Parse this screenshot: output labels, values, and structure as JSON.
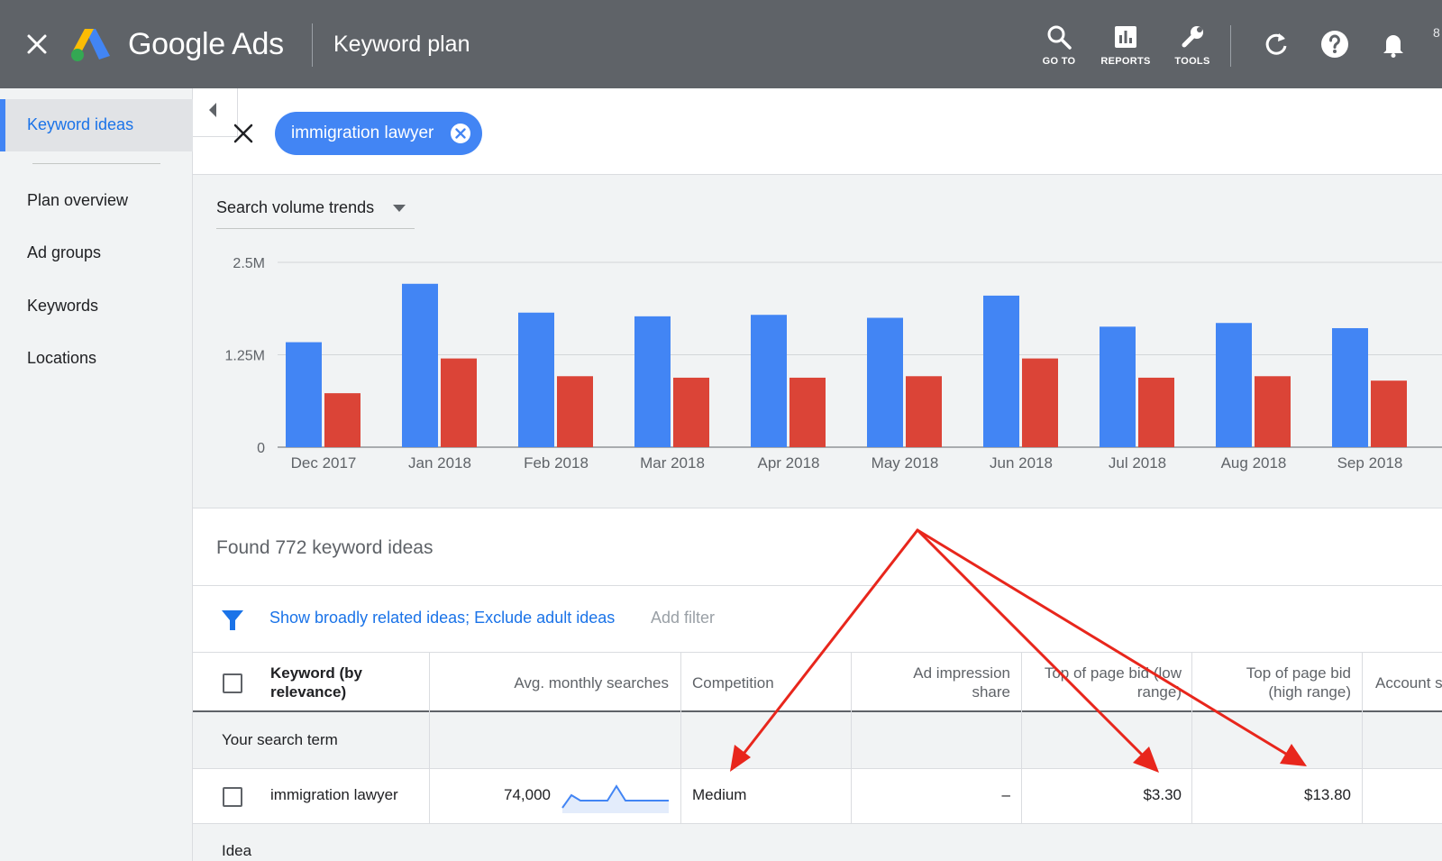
{
  "topbar": {
    "brand": "Google Ads",
    "title": "Keyword plan",
    "tools": [
      {
        "label": "GO TO",
        "icon": "search-icon"
      },
      {
        "label": "REPORTS",
        "icon": "reports-icon"
      },
      {
        "label": "TOOLS",
        "icon": "wrench-icon"
      }
    ],
    "right_icons": [
      "refresh-icon",
      "help-icon",
      "notifications-icon"
    ],
    "partial_text": "8"
  },
  "sidebar": {
    "items": [
      {
        "label": "Keyword ideas",
        "active": true
      },
      {
        "label": "Plan overview"
      },
      {
        "label": "Ad groups"
      },
      {
        "label": "Keywords"
      },
      {
        "label": "Locations"
      }
    ]
  },
  "search": {
    "chip": "immigration lawyer"
  },
  "chart": {
    "dropdown": "Search volume trends"
  },
  "chart_data": {
    "type": "bar",
    "categories": [
      "Dec 2017",
      "Jan 2018",
      "Feb 2018",
      "Mar 2018",
      "Apr 2018",
      "May 2018",
      "Jun 2018",
      "Jul 2018",
      "Aug 2018",
      "Sep 2018"
    ],
    "series": [
      {
        "values": [
          1420000,
          2210000,
          1820000,
          1770000,
          1790000,
          1750000,
          2050000,
          1630000,
          1680000,
          1610000
        ],
        "color": "#4285f4"
      },
      {
        "values": [
          730000,
          1200000,
          960000,
          940000,
          940000,
          960000,
          1200000,
          940000,
          960000,
          900000
        ],
        "color": "#db4437"
      }
    ],
    "yticks": [
      "0",
      "1.25M",
      "2.5M"
    ],
    "ylim": [
      0,
      2500000
    ],
    "grid": true
  },
  "results": {
    "found_text": "Found 772 keyword ideas",
    "filter_link": "Show broadly related ideas; Exclude adult ideas",
    "add_filter": "Add filter"
  },
  "table": {
    "headers": {
      "keyword": [
        "Keyword (by",
        "relevance)"
      ],
      "avg": "Avg. monthly searches",
      "competition": "Competition",
      "impression": [
        "Ad impression",
        "share"
      ],
      "bid_low": [
        "Top of page bid (low",
        "range)"
      ],
      "bid_high": [
        "Top of page bid",
        "(high range)"
      ],
      "account": "Account s"
    },
    "group_label": "Your search term",
    "row": {
      "keyword": "immigration lawyer",
      "avg": "74,000",
      "competition": "Medium",
      "impression": "–",
      "bid_low": "$3.30",
      "bid_high": "$13.80"
    },
    "idea_label": "Idea"
  },
  "colors": {
    "topbar": "#5f6368",
    "accent_blue": "#4285f4",
    "accent_red": "#db4437",
    "annotation_arrow": "#e8261c"
  }
}
